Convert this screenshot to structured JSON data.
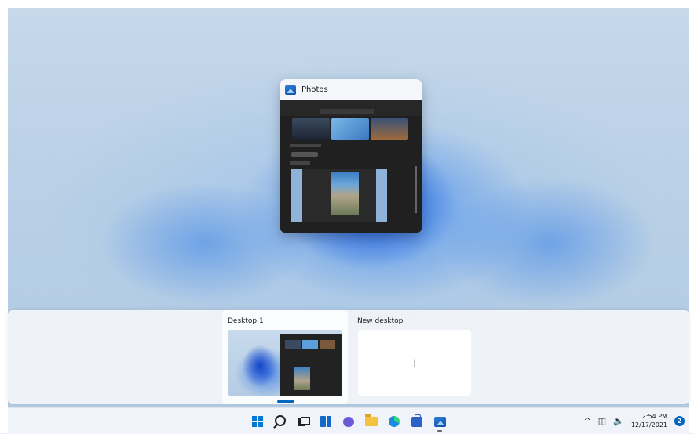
{
  "window_thumbnail": {
    "title": "Photos",
    "icon": "photos-icon"
  },
  "virtual_desktops": [
    {
      "label": "Desktop 1",
      "active": true
    },
    {
      "label": "New desktop",
      "is_add_button": true,
      "symbol": "+"
    }
  ],
  "taskbar": {
    "pinned": [
      {
        "name": "start",
        "icon": "windows-start-icon"
      },
      {
        "name": "search",
        "icon": "search-icon"
      },
      {
        "name": "task-view",
        "icon": "task-view-icon"
      },
      {
        "name": "widgets",
        "icon": "widgets-icon"
      },
      {
        "name": "chat",
        "icon": "chat-icon"
      },
      {
        "name": "file-explorer",
        "icon": "folder-icon"
      },
      {
        "name": "edge",
        "icon": "edge-icon"
      },
      {
        "name": "store",
        "icon": "store-icon"
      },
      {
        "name": "photos",
        "icon": "photos-icon",
        "running": true
      }
    ],
    "tray": {
      "chevron": "^",
      "network_icon": "network-icon",
      "volume_icon": "volume-icon",
      "time": "2:54 PM",
      "date": "12/17/2021",
      "notification_count": "2"
    }
  },
  "colors": {
    "accent": "#0067c0",
    "start_blue": "#0078d4",
    "taskbar_bg": "#f0f3f9"
  }
}
